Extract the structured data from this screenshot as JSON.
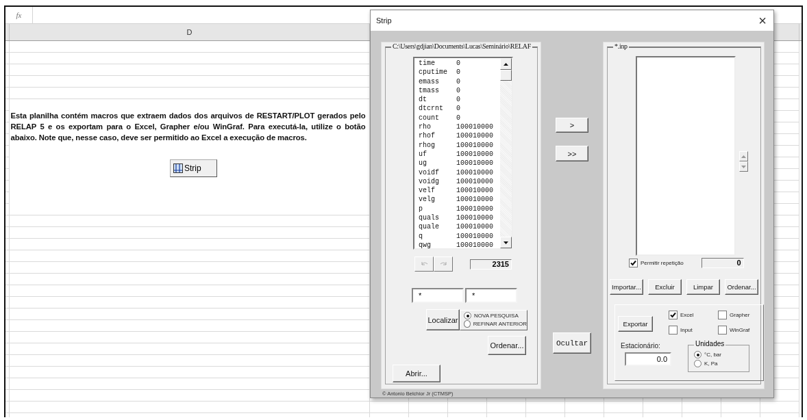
{
  "sheet": {
    "formula_label": "fx",
    "column_header": "D",
    "note": "Esta planilha contém macros que extraem dados dos arquivos de RESTART/PLOT gerados pelo RELAP 5 e os exportam para o Excel, Grapher e/ou WinGraf.  Para executá-la, utilize o botão abaixo.  Note que, nesse caso, deve ser permitido ao Excel a execução de macros.",
    "run_button": "Strip"
  },
  "dialog": {
    "title": "Strip",
    "close": "×",
    "left_panel": {
      "legend": "C:\\Users\\gdjian\\Documents\\Lucas\\Seminário\\RELAF",
      "variables": [
        {
          "name": "time",
          "value": "0"
        },
        {
          "name": "cputime",
          "value": "0"
        },
        {
          "name": "emass",
          "value": "0"
        },
        {
          "name": "tmass",
          "value": "0"
        },
        {
          "name": "dt",
          "value": "0"
        },
        {
          "name": "dtcrnt",
          "value": "0"
        },
        {
          "name": "count",
          "value": "0"
        },
        {
          "name": "rho",
          "value": "100010000"
        },
        {
          "name": "rhof",
          "value": "100010000"
        },
        {
          "name": "rhog",
          "value": "100010000"
        },
        {
          "name": "uf",
          "value": "100010000"
        },
        {
          "name": "ug",
          "value": "100010000"
        },
        {
          "name": "voidf",
          "value": "100010000"
        },
        {
          "name": "voidg",
          "value": "100010000"
        },
        {
          "name": "velf",
          "value": "100010000"
        },
        {
          "name": "velg",
          "value": "100010000"
        },
        {
          "name": "p",
          "value": "100010000"
        },
        {
          "name": "quals",
          "value": "100010000"
        },
        {
          "name": "quale",
          "value": "100010000"
        },
        {
          "name": "q",
          "value": "100010000"
        },
        {
          "name": "qwg",
          "value": "100010000"
        }
      ],
      "history_buttons": [
        {
          "kind": "undo",
          "disabled": true
        },
        {
          "kind": "redo",
          "disabled": true
        }
      ],
      "count": "2315",
      "search_fields": [
        "*",
        "*"
      ],
      "find_button": "Localizar",
      "search_modes": [
        {
          "label": "NOVA PESQUISA",
          "selected": true
        },
        {
          "label": "REFINAR ANTERIOR",
          "selected": false
        }
      ],
      "sort_button": "Ordenar...",
      "open_button": "Abrir..."
    },
    "add_button": ">",
    "add_all_button": ">>",
    "hide_button": "Ocultar",
    "right_panel": {
      "legend": "*.inp",
      "allow_repeat": {
        "label": "Permitir repetição",
        "checked": true
      },
      "count": "0",
      "buttons": [
        "Importar...",
        "Excluir",
        "Limpar",
        "Ordenar..."
      ],
      "export_button": "Exportar",
      "formats": [
        {
          "label": "Excel",
          "checked": true
        },
        {
          "label": "Grapher",
          "checked": false
        },
        {
          "label": "Input",
          "checked": false
        },
        {
          "label": "WinGraf",
          "checked": false
        }
      ],
      "steady_label": "Estacionário:",
      "steady_value": "0.0",
      "units_legend": "Unidades",
      "units": [
        {
          "label": "°C, bar",
          "selected": true
        },
        {
          "label": "K, Pa",
          "selected": false
        }
      ]
    },
    "credit": "© Antonio Belchior Jr (CTMSP)"
  }
}
